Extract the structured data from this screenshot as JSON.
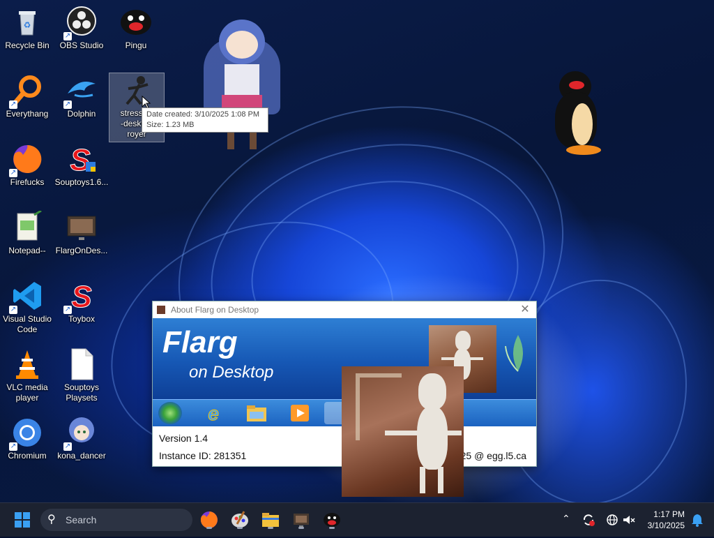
{
  "desktop": {
    "icons": [
      {
        "label": "Recycle Bin"
      },
      {
        "label": "OBS Studio"
      },
      {
        "label": "Pingu"
      },
      {
        "label": "Everythang"
      },
      {
        "label": "Dolphin"
      },
      {
        "label": "stress-re\n-desktop\nroyer"
      },
      {
        "label": "Firefucks"
      },
      {
        "label": "Souptoys1.6..."
      },
      {
        "label": "Notepad--"
      },
      {
        "label": "FlargOnDes..."
      },
      {
        "label": "Visual Studio Code"
      },
      {
        "label": "Toybox"
      },
      {
        "label": "VLC media player"
      },
      {
        "label": "Souptoys Playsets"
      },
      {
        "label": "Chromium"
      },
      {
        "label": "kona_dancer"
      }
    ]
  },
  "tooltip": {
    "created": "Date created: 3/10/2025 1:08 PM",
    "size": "Size: 1.23 MB"
  },
  "about_window": {
    "title": "About Flarg on Desktop",
    "close": "✕",
    "banner_title": "Flarg",
    "banner_sub": "on Desktop",
    "version": "Version 1.4",
    "instance": "Instance ID: 281351",
    "credit": "25 @ egg.l5.ca"
  },
  "taskbar": {
    "search_placeholder": "Search",
    "time": "1:17 PM",
    "date": "3/10/2025"
  },
  "colors": {
    "accent": "#1657b4",
    "taskbar_bg": "#1c2230"
  }
}
